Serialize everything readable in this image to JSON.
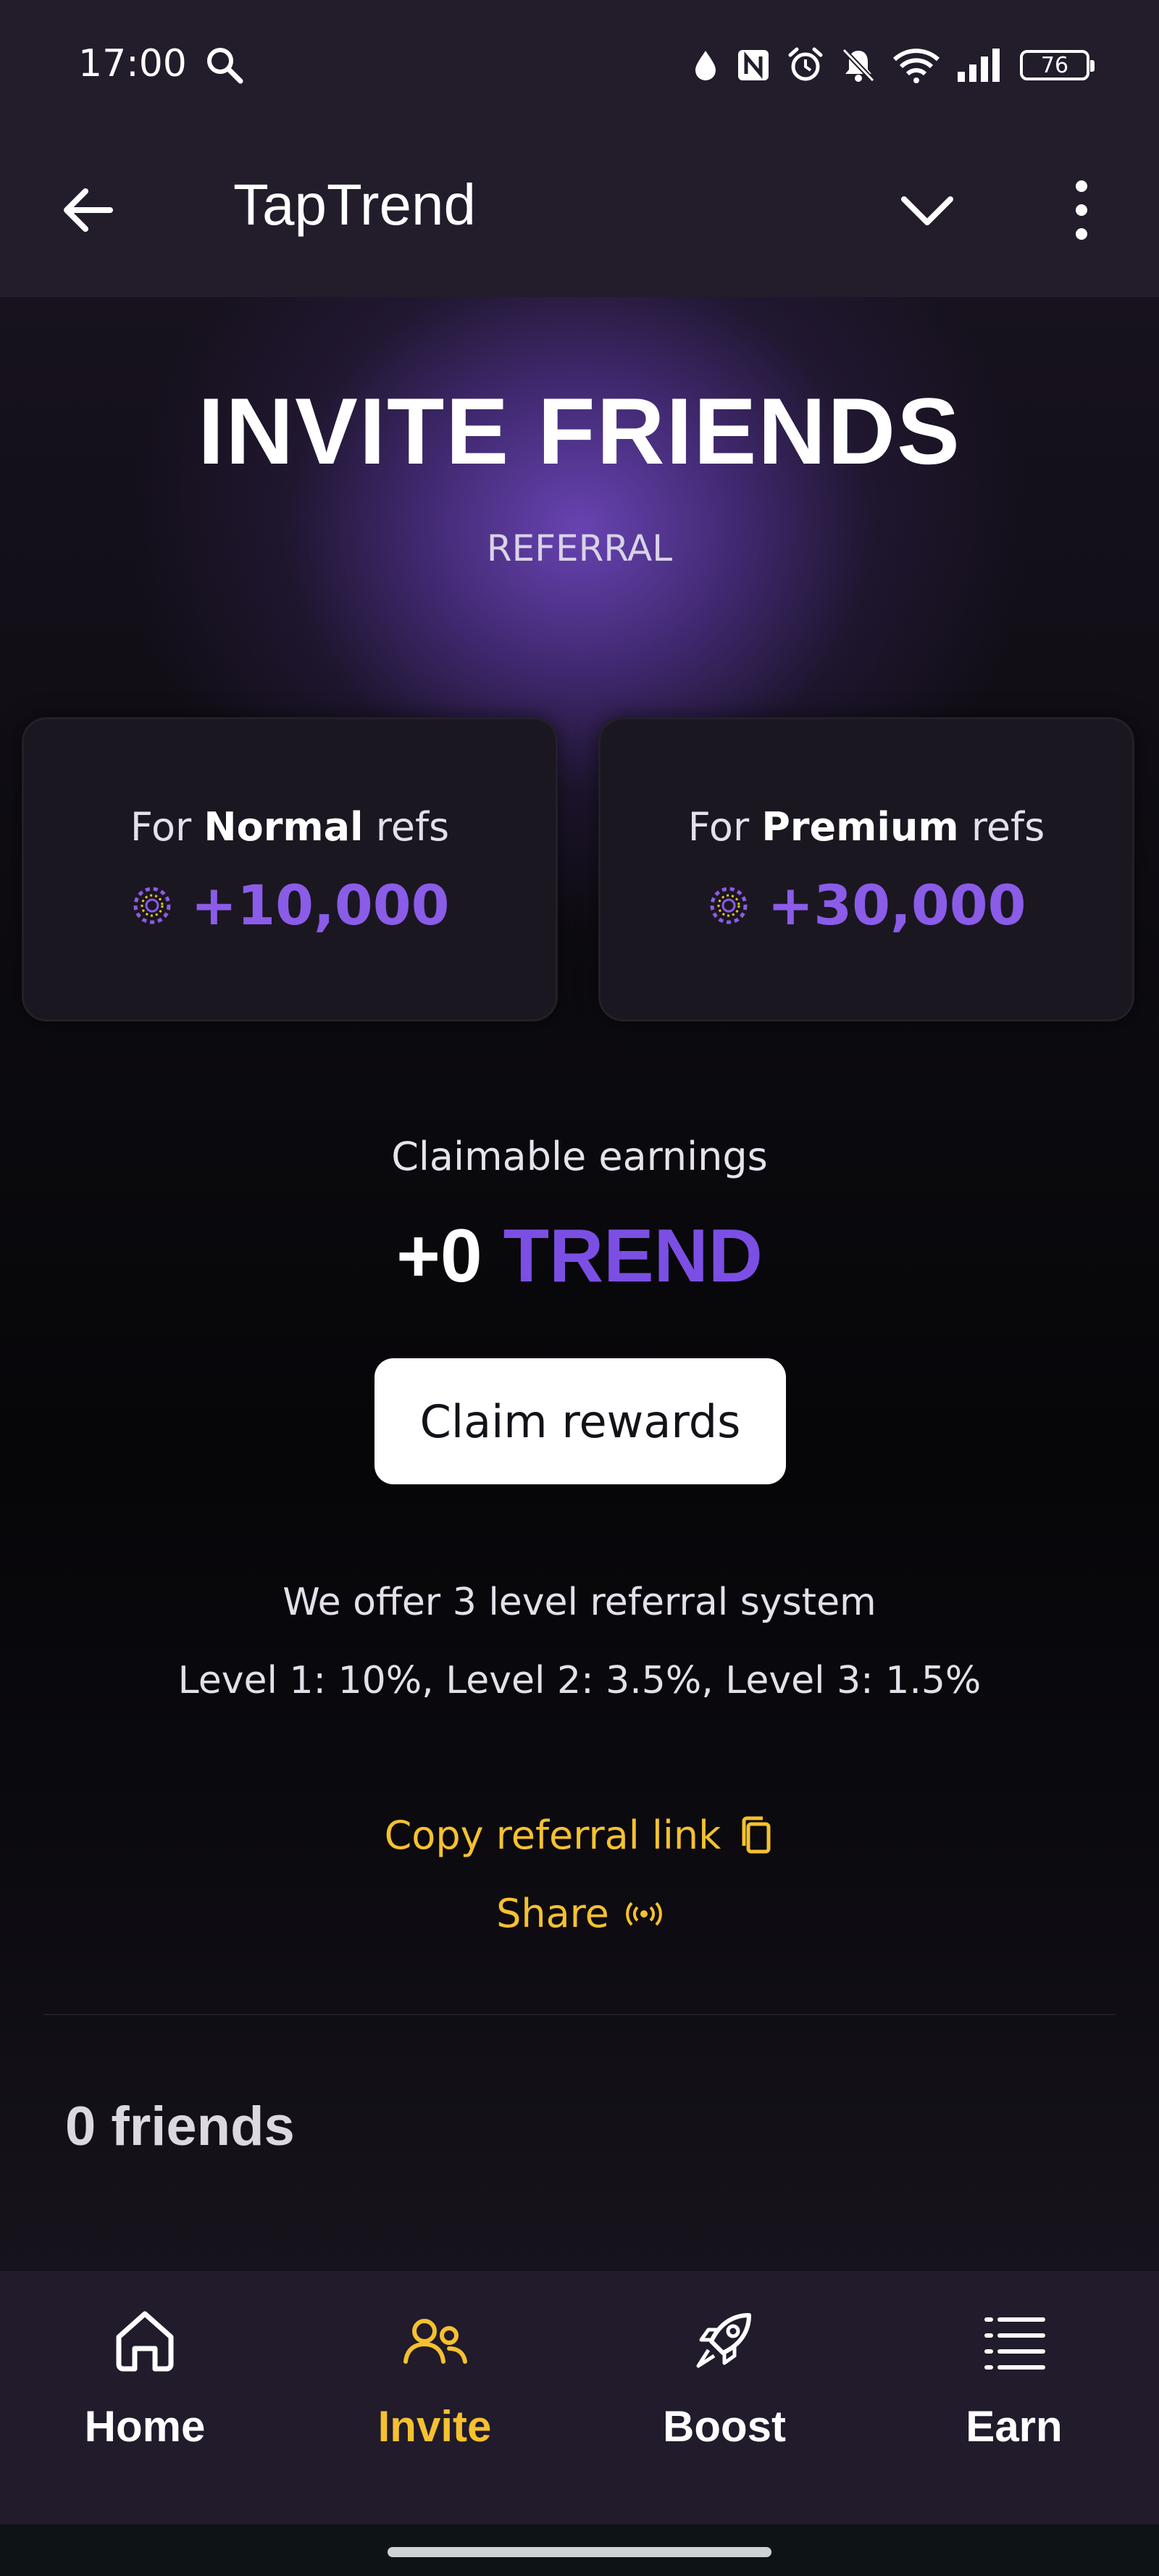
{
  "status_bar": {
    "time": "17:00",
    "battery": "76",
    "icons": [
      "search-icon",
      "drop-icon",
      "nfc-icon",
      "alarm-icon",
      "bell-off-icon",
      "wifi-icon",
      "signal-icon",
      "battery-icon"
    ]
  },
  "app_bar": {
    "title": "TapTrend",
    "icons": [
      "back-arrow-icon",
      "chevron-down-icon",
      "more-vertical-icon"
    ]
  },
  "hero": {
    "title": "INVITE FRIENDS",
    "subtitle": "REFERRAL"
  },
  "cards": [
    {
      "prefix": "For ",
      "tier": "Normal",
      "suffix": " refs",
      "reward": "+10,000"
    },
    {
      "prefix": "For ",
      "tier": "Premium",
      "suffix": " refs",
      "reward": "+30,000"
    }
  ],
  "claim": {
    "caption": "Claimable earnings",
    "amount": "+0",
    "currency": "TREND",
    "button_label": "Claim rewards"
  },
  "referral_info": {
    "line1": "We offer 3 level referral system",
    "line2": "Level 1: 10%, Level 2: 3.5%, Level 3: 1.5%"
  },
  "links": {
    "copy_label": "Copy referral link",
    "share_label": "Share"
  },
  "friends": {
    "count_label": "0 friends"
  },
  "nav": {
    "items": [
      {
        "label": "Home",
        "icon": "home-icon",
        "active": false
      },
      {
        "label": "Invite",
        "icon": "users-icon",
        "active": true
      },
      {
        "label": "Boost",
        "icon": "rocket-icon",
        "active": false
      },
      {
        "label": "Earn",
        "icon": "list-icon",
        "active": false
      }
    ]
  },
  "colors": {
    "accent_purple": "#7b4fe3",
    "accent_yellow": "#f5c130",
    "app_bar_bg": "#221c2b"
  }
}
